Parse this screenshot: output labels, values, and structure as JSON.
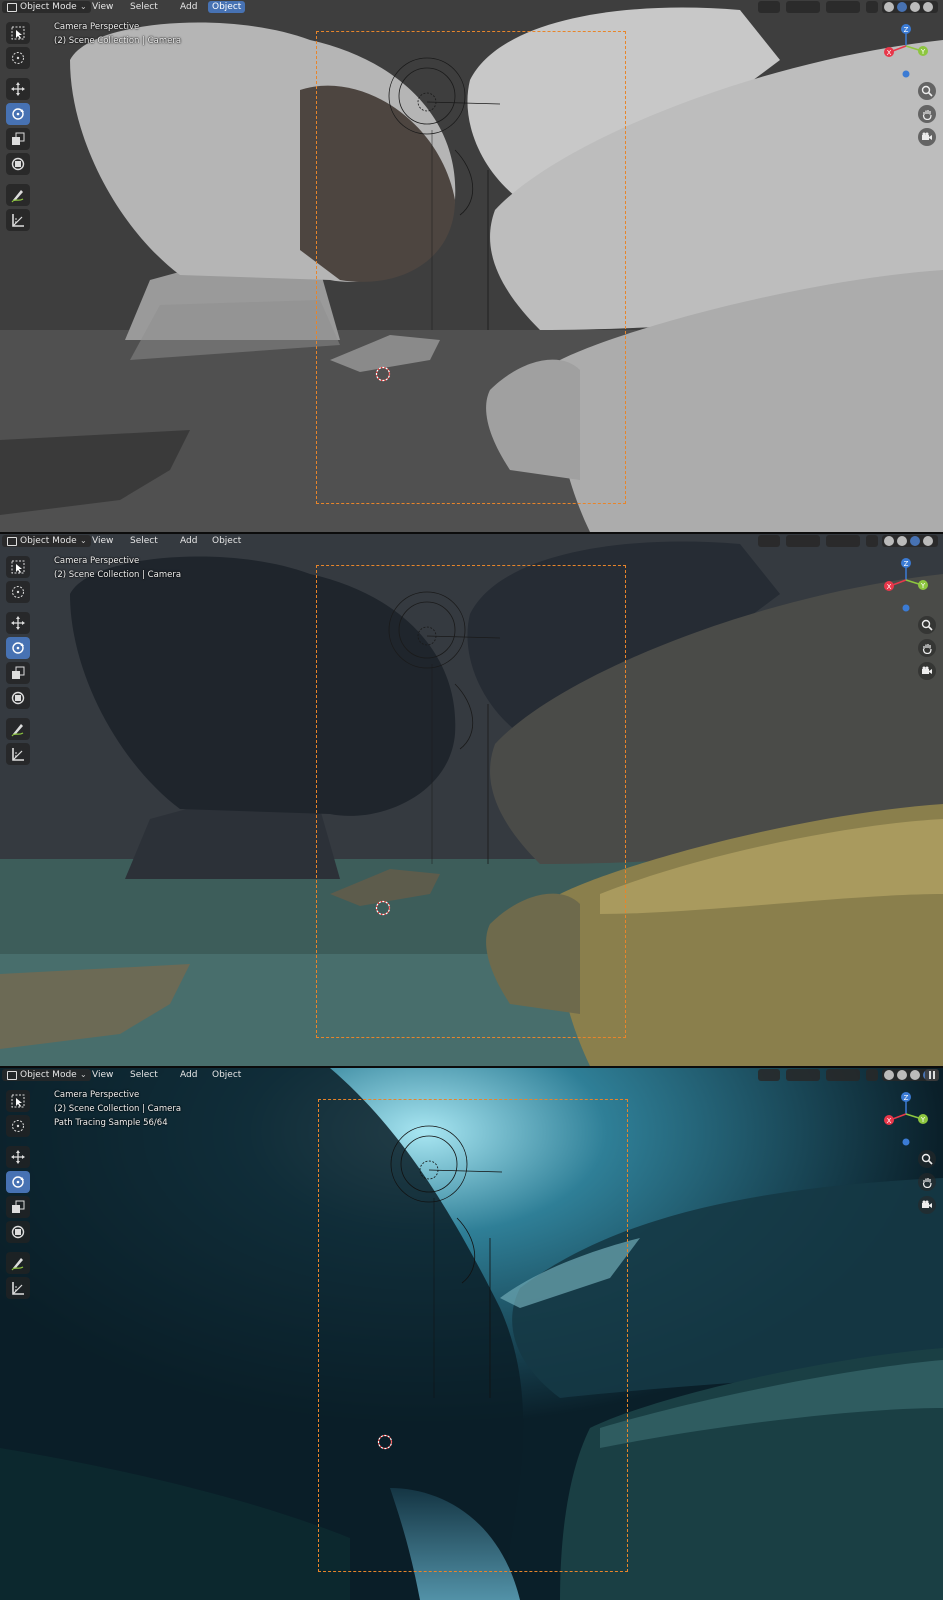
{
  "header": {
    "mode_label": "Object Mode",
    "menu": [
      "View",
      "Select",
      "Add",
      "Object"
    ],
    "active_menu": "Object"
  },
  "viewports": [
    {
      "shading": "solid",
      "overlay": {
        "line1": "Camera Perspective",
        "line2": "(2) Scene Collection | Camera",
        "line3": ""
      }
    },
    {
      "shading": "material-preview",
      "overlay": {
        "line1": "Camera Perspective",
        "line2": "(2) Scene Collection | Camera",
        "line3": ""
      }
    },
    {
      "shading": "rendered",
      "overlay": {
        "line1": "Camera Perspective",
        "line2": "(2) Scene Collection | Camera",
        "line3": "Path Tracing Sample 56/64"
      }
    }
  ],
  "gizmo": {
    "x": "X",
    "y": "Y",
    "z": "Z"
  },
  "tools": [
    "select-box",
    "cursor",
    "move",
    "rotate",
    "scale",
    "transform",
    "annotate",
    "measure"
  ],
  "colors": {
    "accent": "#4772b3",
    "camera_frame": "#e8852a",
    "axis_x": "#e8374a",
    "axis_y": "#8dc63f",
    "axis_z": "#3b7bd4"
  }
}
